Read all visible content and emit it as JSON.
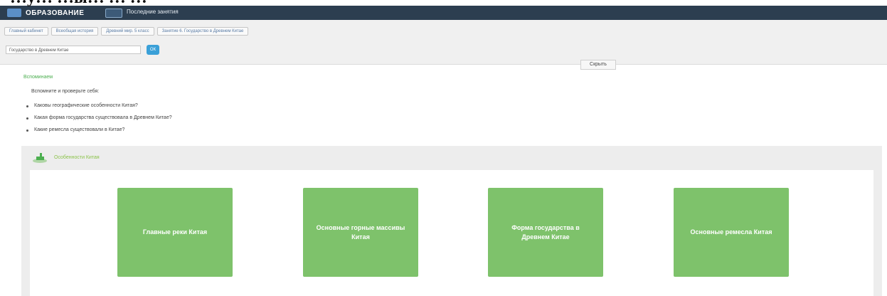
{
  "caption": "…у… …ы… … …",
  "header": {
    "logo_text": "ОБРАЗОВАНИЕ",
    "title": "Последние занятия"
  },
  "breadcrumbs": [
    "Главный кабинет",
    "Всеобщая история",
    "Древний мир. 5 класс",
    "Занятие 6. Государство в Древнем Китае"
  ],
  "select_value": "Государство в Древнем Китае",
  "go_button": "ОК",
  "hide_button": "Скрыть",
  "section_label": "Вспоминаем",
  "intro_text": "Вспомните и проверьте себя:",
  "questions": [
    "Каковы географические особенности Китая?",
    "Какая форма государства существовала в Древнем Китае?",
    "Какие ремесла существовали в Китае?"
  ],
  "panel": {
    "title": "Особенности Китая",
    "tiles": [
      "Главные реки Китая",
      "Основные горные массивы Китая",
      "Форма государства в Древнем Китае",
      "Основные ремесла Китая"
    ]
  },
  "colors": {
    "topbar": "#2c3e50",
    "tile": "#7ec26b",
    "accent_green": "#4caf50",
    "button_blue": "#3aa0d8"
  }
}
